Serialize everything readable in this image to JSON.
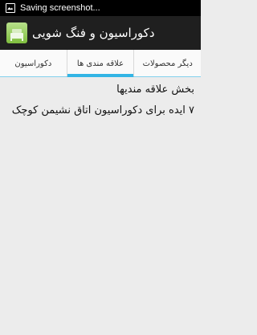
{
  "status_bar": {
    "text": "Saving screenshot..."
  },
  "action_bar": {
    "title": "دکوراسیون و فنگ شویی"
  },
  "tabs": [
    {
      "label": "دکوراسیون"
    },
    {
      "label": "علاقه مندی ها"
    },
    {
      "label": "دیگر محصولات"
    }
  ],
  "content": {
    "items": [
      {
        "text": "بخش علاقه مندیها"
      },
      {
        "text": "۷ ایده برای دکوراسیون اتاق نشیمن کوچک"
      }
    ]
  },
  "colors": {
    "accent": "#33b5e5",
    "action_bar": "#1f1f1f",
    "status_bar": "#000000",
    "background": "#ececec"
  }
}
